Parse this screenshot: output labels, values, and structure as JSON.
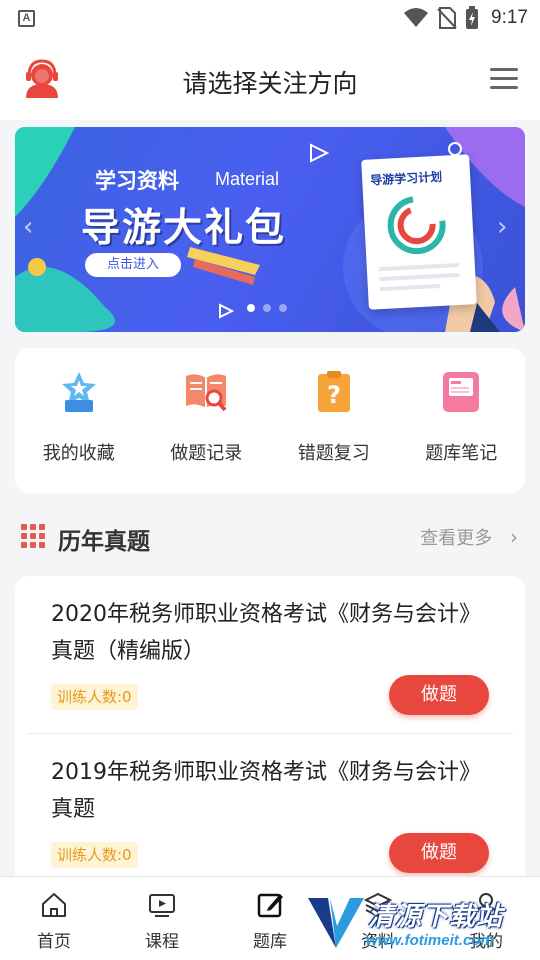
{
  "status_bar": {
    "app_badge": "A",
    "time": "9:17"
  },
  "header": {
    "title": "请选择关注方向"
  },
  "banner": {
    "tag": "学习资料",
    "tag_en": "Material",
    "headline": "导游大礼包",
    "button": "点击进入",
    "doc_title": "导游学习计划"
  },
  "tools": [
    {
      "label": "我的收藏",
      "icon": "star-badge-icon"
    },
    {
      "label": "做题记录",
      "icon": "book-search-icon"
    },
    {
      "label": "错题复习",
      "icon": "question-clipboard-icon"
    },
    {
      "label": "题库笔记",
      "icon": "notebook-icon"
    }
  ],
  "section": {
    "title": "历年真题",
    "more": "查看更多"
  },
  "papers": [
    {
      "title": "2020年税务师职业资格考试《财务与会计》真题（精编版）",
      "count": "训练人数:0",
      "action": "做题"
    },
    {
      "title": "2019年税务师职业资格考试《财务与会计》真题",
      "count": "训练人数:0",
      "action": "做题"
    }
  ],
  "nav": [
    {
      "label": "首页",
      "icon": "home-icon"
    },
    {
      "label": "课程",
      "icon": "video-icon"
    },
    {
      "label": "题库",
      "icon": "edit-icon"
    },
    {
      "label": "资料",
      "icon": "layers-icon"
    },
    {
      "label": "我的",
      "icon": "user-icon"
    }
  ],
  "watermark": {
    "cn": "清源下载站",
    "en": "www.fotimeit.com"
  },
  "colors": {
    "accent": "#e8473d",
    "banner_blue": "#3b63e0",
    "count_bg": "#fff3d6",
    "count_text": "#e69a1c"
  }
}
